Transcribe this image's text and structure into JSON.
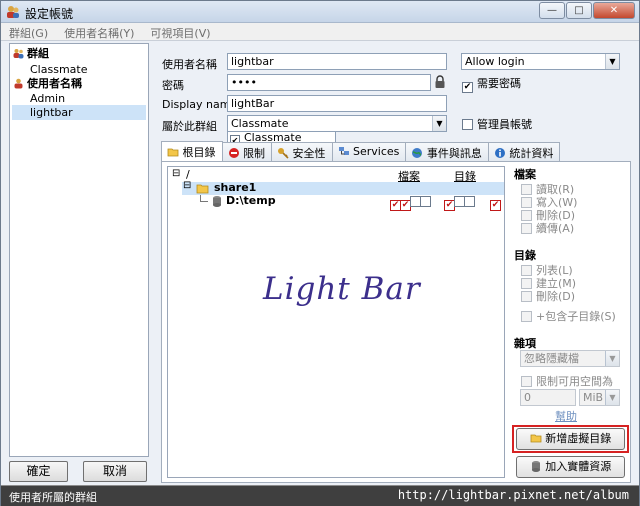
{
  "window": {
    "title": "設定帳號"
  },
  "menu": [
    "群組(G)",
    "使用者名稱(Y)",
    "可視項目(V)"
  ],
  "caption": {
    "minimize": "—",
    "maximize": "□",
    "close": "✕"
  },
  "tree": {
    "groups_label": "群組",
    "groups": [
      "Classmate"
    ],
    "users_label": "使用者名稱",
    "users": [
      "Admin",
      "lightbar"
    ]
  },
  "left_buttons": {
    "ok": "確定",
    "cancel": "取消"
  },
  "form": {
    "username_label": "使用者名稱",
    "username_value": "lightbar",
    "password_label": "密碼",
    "password_value": "••••",
    "display_label": "Display name",
    "display_value": "lightBar",
    "group_label": "屬於此群組",
    "group_value": "Classmate",
    "group_option": "Classmate",
    "login_value": "Allow login",
    "require_password_label": "需要密碼",
    "admin_label": "管理員帳號"
  },
  "tabs": [
    "根目錄",
    "限制",
    "安全性",
    "Services",
    "事件與訊息",
    "統計資料"
  ],
  "perm_list": {
    "root": "/",
    "col_files": "檔案",
    "col_dirs": "目錄",
    "rows": [
      {
        "name": "share1"
      },
      {
        "name": "D:\\temp"
      }
    ]
  },
  "files_section": {
    "title": "檔案",
    "items": [
      "讀取(R)",
      "寫入(W)",
      "刪除(D)",
      "續傳(A)"
    ]
  },
  "dirs_section": {
    "title": "目錄",
    "items": [
      "列表(L)",
      "建立(M)",
      "刪除(D)"
    ],
    "subdirs": "+包含子目錄(S)"
  },
  "misc_section": {
    "title": "雜項",
    "hidden_value": "忽略隱藏檔",
    "limit_label": "限制可用空間為",
    "limit_value": "0",
    "unit_value": "MiB",
    "help_link": "幫助"
  },
  "actions": {
    "add_virtual": "新增虛擬目錄",
    "add_physical": "加入實體資源"
  },
  "watermark": "Light Bar",
  "status": {
    "text": "使用者所屬的群組",
    "url": "http://lightbar.pixnet.net/album"
  },
  "colors": {
    "accent_red": "#d62222",
    "check_red": "#c01818",
    "selection": "#cde3f8"
  }
}
